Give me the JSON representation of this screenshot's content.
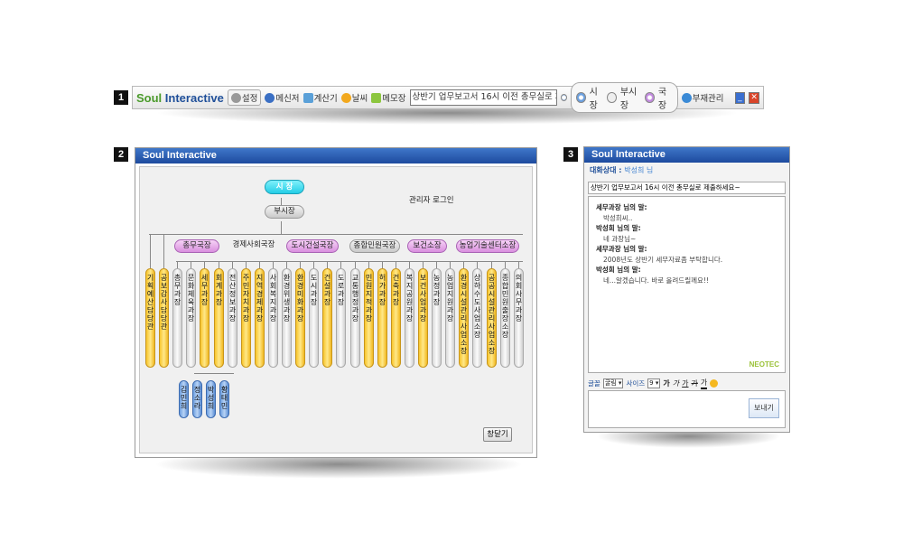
{
  "badges": [
    "1",
    "2",
    "3"
  ],
  "brand": {
    "soul": "Soul",
    "interactive": "Interactive"
  },
  "toolbar": {
    "settings": "설정",
    "sender": "메신저",
    "calculator": "계산기",
    "weather": "날씨",
    "memo": "메모장",
    "notice": "상반기 업무보고서 16시 이전 총무실로 제출하",
    "radio_mayor": "시장",
    "radio_vice": "부시장",
    "radio_director": "국장",
    "absence": "부재관리",
    "minimize": "_",
    "close": "✕"
  },
  "org": {
    "title": "Soul Interactive",
    "admin_login": "관리자 로그인",
    "mayor": "시  장",
    "vice_mayor": "부시장",
    "bureaus": [
      "총무국장",
      "경제사회국장",
      "도시건설국장",
      "종합민원국장",
      "보건소장",
      "농업기술센터소장"
    ],
    "departments": [
      "기획예산담당관",
      "공보감사담당관",
      "총무과장",
      "문화체육과장",
      "세무과장",
      "회계과장",
      "전산정보과장",
      "주민자치과장",
      "지역경제과장",
      "사회복지과장",
      "환경위생과장",
      "환경미화과장",
      "도시과장",
      "건설과장",
      "도로과장",
      "교통행정과장",
      "민원지적과장",
      "허가과장",
      "건축과장",
      "복지공원과장",
      "보건사업과장",
      "농정과장",
      "농업지원과장",
      "환경시설관리사업소장",
      "상하수도사업소장",
      "공공시설관리사업소장",
      "종합민원출장소장",
      "의회사무과장"
    ],
    "staff": [
      "김민희",
      "정소라",
      "박성희",
      "황태민"
    ],
    "close_button": "창닫기"
  },
  "chat": {
    "title": "Soul Interactive",
    "partner_label": "대화상대 :",
    "partner_name": "박성희 님",
    "status": "상반기 업무보고서 16시 이전 총무실로 제출하세요~",
    "messages": [
      {
        "who": "세무과장 님의 말:",
        "text": "박성희씨.."
      },
      {
        "who": "박성희 님의 말:",
        "text": "네 과장님~"
      },
      {
        "who": "세무과장 님의 말:",
        "text": "2008년도 상반기 세무자료좀 부탁합니다."
      },
      {
        "who": "박성희 님의 말:",
        "text": "네...알겠습니다. 바로 올려드릴께요!!"
      }
    ],
    "watermark": "NEOTEC",
    "font_label": "글꼴",
    "font_value": "굴림",
    "size_label": "사이즈",
    "size_value": "9",
    "format_buttons": [
      "가",
      "가",
      "가",
      "가",
      "가"
    ],
    "send": "보내기"
  }
}
